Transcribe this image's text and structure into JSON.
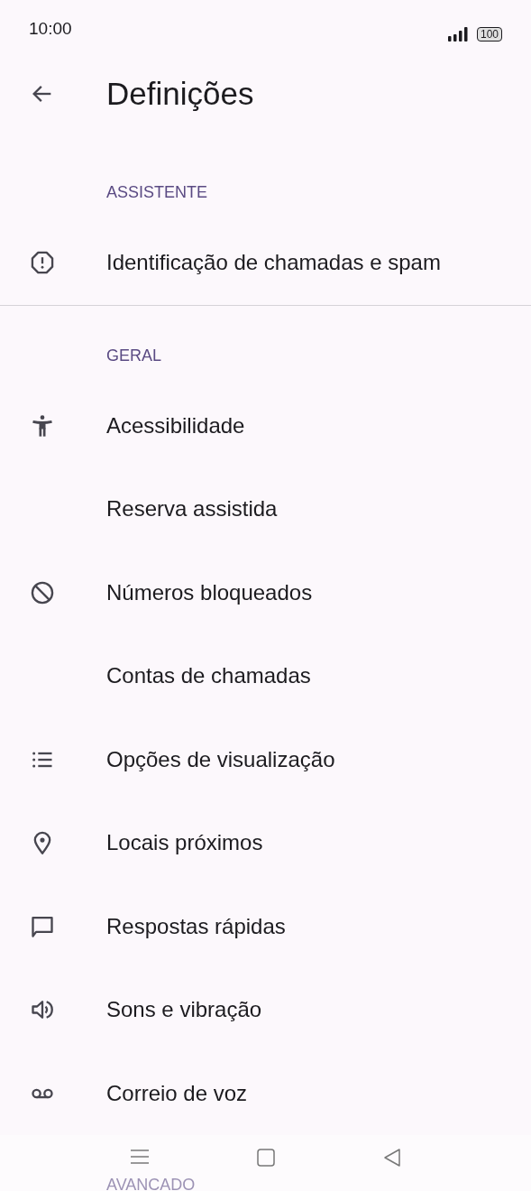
{
  "status_bar": {
    "time": "10:00",
    "battery": "100"
  },
  "header": {
    "title": "Definições"
  },
  "sections": [
    {
      "title": "ASSISTENTE",
      "items": [
        {
          "label": "Identificação de chamadas e spam",
          "kind": "alert"
        }
      ]
    },
    {
      "title": "GERAL",
      "items": [
        {
          "label": "Acessibilidade",
          "kind": "accessibility"
        },
        {
          "label": "Reserva assistida",
          "kind": "plain"
        },
        {
          "label": "Números bloqueados",
          "kind": "block"
        },
        {
          "label": "Contas de chamadas",
          "kind": "plain"
        },
        {
          "label": "Opções de visualização",
          "kind": "list"
        },
        {
          "label": "Locais próximos",
          "kind": "pin"
        },
        {
          "label": "Respostas rápidas",
          "kind": "chat"
        },
        {
          "label": "Sons e vibração",
          "kind": "volume"
        },
        {
          "label": "Correio de voz",
          "kind": "voicemail"
        }
      ]
    },
    {
      "title": "AVANCADO"
    }
  ]
}
